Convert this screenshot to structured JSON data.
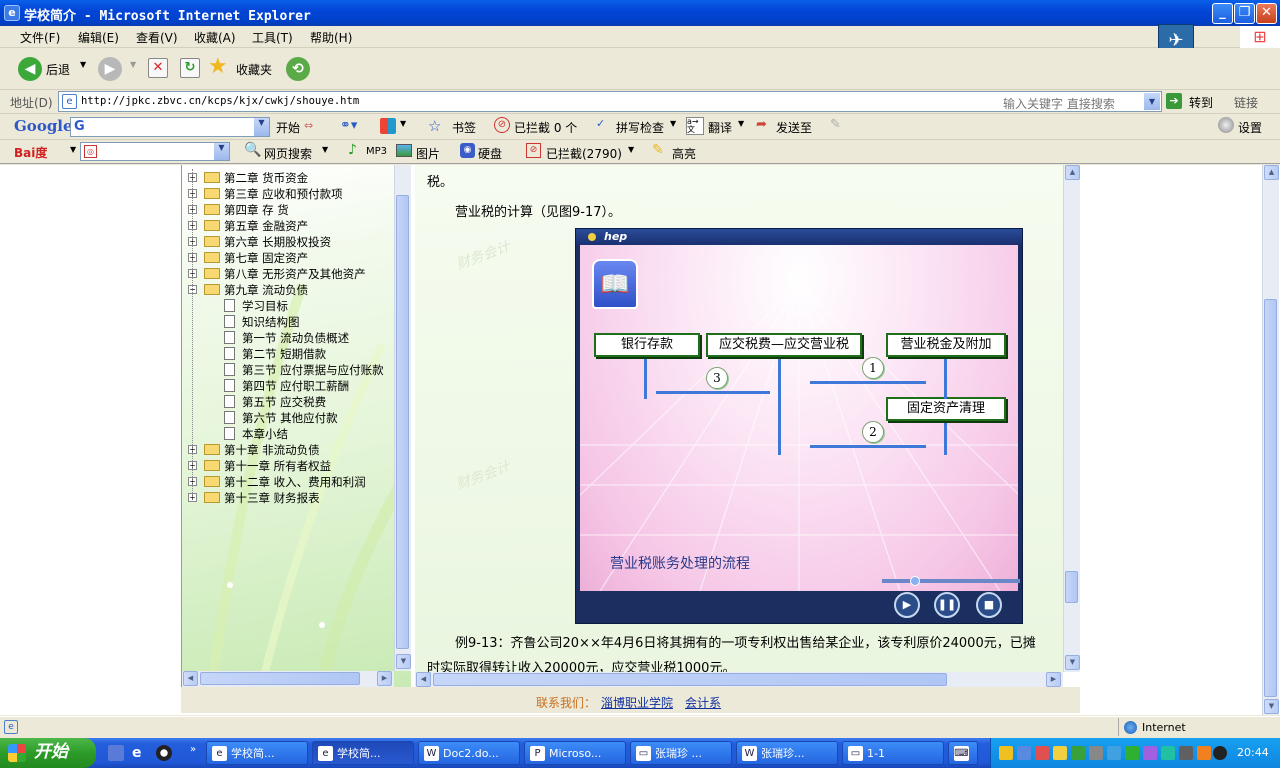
{
  "window": {
    "title": "学校简介 - Microsoft Internet Explorer",
    "app_icon": "ie-icon"
  },
  "menu": [
    "文件(F)",
    "编辑(E)",
    "查看(V)",
    "收藏(A)",
    "工具(T)",
    "帮助(H)"
  ],
  "toolbar": {
    "back_label": "后退",
    "favorites_label": "收藏夹"
  },
  "address": {
    "label": "地址(D)",
    "url": "http://jpkc.zbvc.cn/kcps/kjx/cwkj/shouye.htm",
    "search_hint": "输入关键字 直接搜索",
    "go_label": "转到",
    "links_label": "链接"
  },
  "google_bar": {
    "logo": "Google",
    "search_value": "G",
    "start_label": "开始",
    "bookmarks_label": "书签",
    "blocked_label": "已拦截 0 个",
    "spellcheck_label": "拼写检查",
    "translate_label": "翻译",
    "sendto_label": "发送至",
    "settings_label": "设置"
  },
  "baidu_bar": {
    "logo": "Bai度",
    "search_label": "网页搜索",
    "mp3_label": "MP3",
    "image_label": "图片",
    "disk_label": "硬盘",
    "blocked_label": "已拦截(2790)",
    "highlight_label": "高亮"
  },
  "tree": {
    "items": [
      {
        "label": "第二章 货币资金",
        "type": "folder",
        "level": 0,
        "expanded": false
      },
      {
        "label": "第三章 应收和预付款项",
        "type": "folder",
        "level": 0,
        "expanded": false
      },
      {
        "label": "第四章 存 货",
        "type": "folder",
        "level": 0,
        "expanded": false
      },
      {
        "label": "第五章 金融资产",
        "type": "folder",
        "level": 0,
        "expanded": false
      },
      {
        "label": "第六章 长期股权投资",
        "type": "folder",
        "level": 0,
        "expanded": false
      },
      {
        "label": "第七章 固定资产",
        "type": "folder",
        "level": 0,
        "expanded": false
      },
      {
        "label": "第八章 无形资产及其他资产",
        "type": "folder",
        "level": 0,
        "expanded": false
      },
      {
        "label": "第九章 流动负债",
        "type": "folder",
        "level": 0,
        "expanded": true
      },
      {
        "label": "学习目标",
        "type": "page",
        "level": 1
      },
      {
        "label": "知识结构图",
        "type": "page",
        "level": 1
      },
      {
        "label": "第一节 流动负债概述",
        "type": "page",
        "level": 1
      },
      {
        "label": "第二节 短期借款",
        "type": "page",
        "level": 1
      },
      {
        "label": "第三节 应付票据与应付账款",
        "type": "page",
        "level": 1
      },
      {
        "label": "第四节 应付职工薪酬",
        "type": "page",
        "level": 1
      },
      {
        "label": "第五节 应交税费",
        "type": "page",
        "level": 1
      },
      {
        "label": "第六节 其他应付款",
        "type": "page",
        "level": 1
      },
      {
        "label": "本章小结",
        "type": "page",
        "level": 1
      },
      {
        "label": "第十章 非流动负债",
        "type": "folder",
        "level": 0,
        "expanded": false
      },
      {
        "label": "第十一章 所有者权益",
        "type": "folder",
        "level": 0,
        "expanded": false
      },
      {
        "label": "第十二章 收入、费用和利润",
        "type": "folder",
        "level": 0,
        "expanded": false
      },
      {
        "label": "第十三章 财务报表",
        "type": "folder",
        "level": 0,
        "expanded": false
      }
    ]
  },
  "article": {
    "top_text": "税。",
    "intro": "营业税的计算（见图9-17）。",
    "example_line1": "例9-13：齐鲁公司20××年4月6日将其拥有的一项专利权出售给某企业，该专利原价24000元，已摊",
    "example_line2": "时实际取得转让收入20000元，应交营业税1000元。",
    "watermark": "财务会计"
  },
  "flash": {
    "header_label": "hep",
    "box_bank": "银行存款",
    "box_payable": "应交税费—应交营业税",
    "box_tax": "营业税金及附加",
    "box_asset": "固定资产清理",
    "step1": "1",
    "step2": "2",
    "step3": "3",
    "caption": "营业税账务处理的流程"
  },
  "footer": {
    "contact_label": "联系我们：",
    "link1": "淄博职业学院",
    "link2": "会计系"
  },
  "statusbar": {
    "zone": "Internet"
  },
  "taskbar": {
    "start_label": "开始",
    "tasks": [
      {
        "label": "学校简...",
        "icon": "ie-icon",
        "active": false
      },
      {
        "label": "学校简...",
        "icon": "ie-icon",
        "active": true
      },
      {
        "label": "Doc2.do...",
        "icon": "word-icon",
        "active": false
      },
      {
        "label": "Microso...",
        "icon": "ppt-icon",
        "active": false
      },
      {
        "label": "张瑞珍 ...",
        "icon": "folder-icon",
        "active": false
      },
      {
        "label": "张瑞珍...",
        "icon": "word-icon",
        "active": false
      },
      {
        "label": "1-1",
        "icon": "folder-icon",
        "active": false
      }
    ],
    "clock": "20:44"
  }
}
